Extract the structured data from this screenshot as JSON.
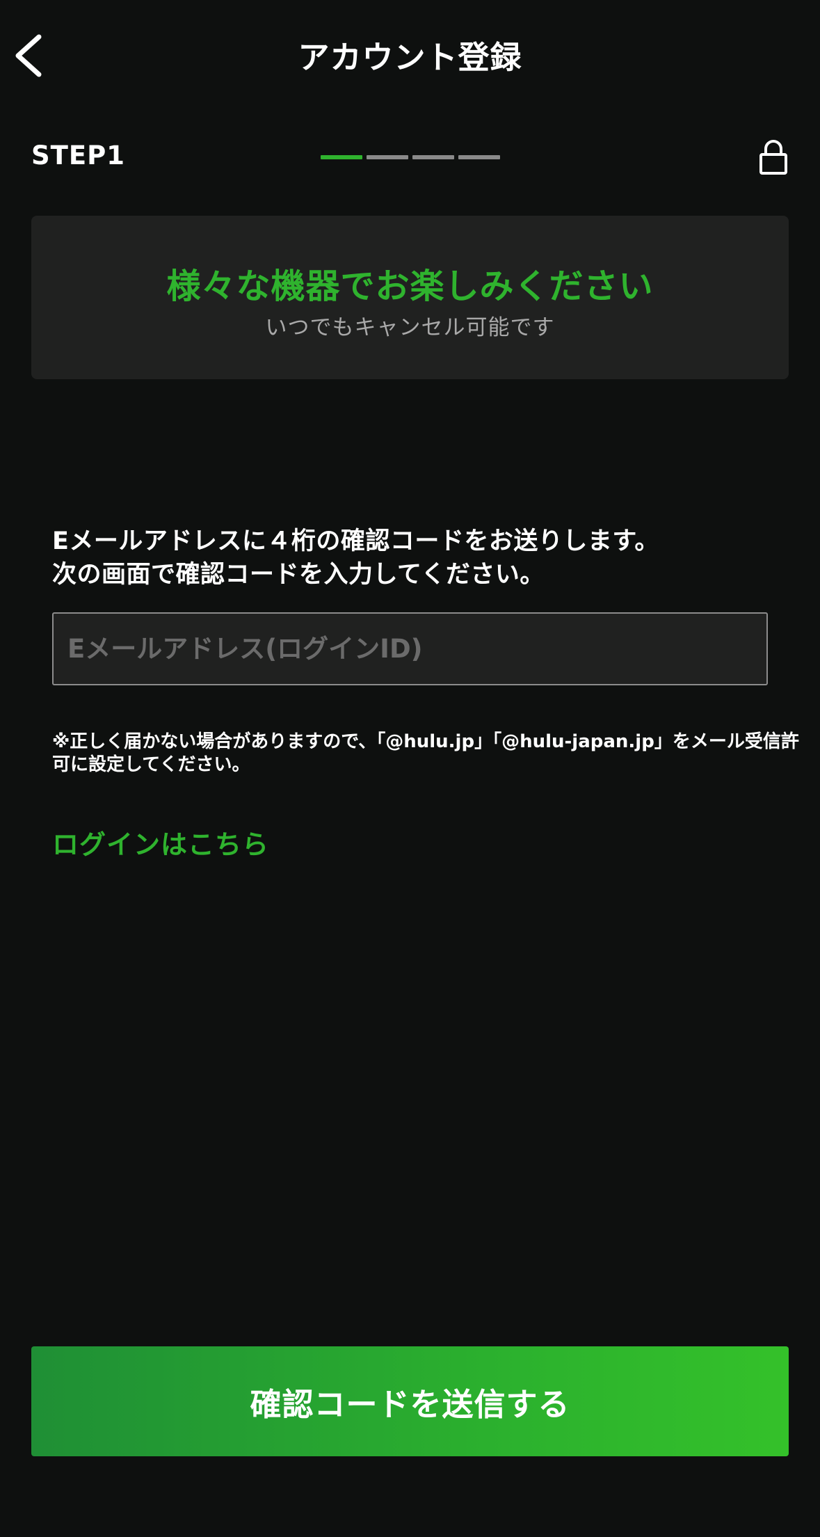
{
  "header": {
    "title": "アカウント登録",
    "back_icon": "chevron-left-icon"
  },
  "step": {
    "label": "STEP1",
    "current": 1,
    "total": 4,
    "accent_color": "#2fb32e",
    "lock_icon": "lock-icon"
  },
  "banner": {
    "headline": "様々な機器でお楽しみください",
    "subtext": "いつでもキャンセル可能です"
  },
  "instructions": {
    "line1": "Eメールアドレスに４桁の確認コードをお送りします。",
    "line2": "次の画面で確認コードを入力してください。"
  },
  "email": {
    "placeholder": "Eメールアドレス(ログインID)",
    "value": ""
  },
  "note": {
    "line1": "※正しく届かない場合がありますので、「@hulu.jp」「@hulu-japan.jp」をメール受信許",
    "line2": "可に設定してください。"
  },
  "login_link": "ログインはこちら",
  "submit": {
    "label": "確認コードを送信する"
  },
  "colors": {
    "background": "#0e100f",
    "accent": "#2fb32e",
    "panel": "#202120"
  }
}
